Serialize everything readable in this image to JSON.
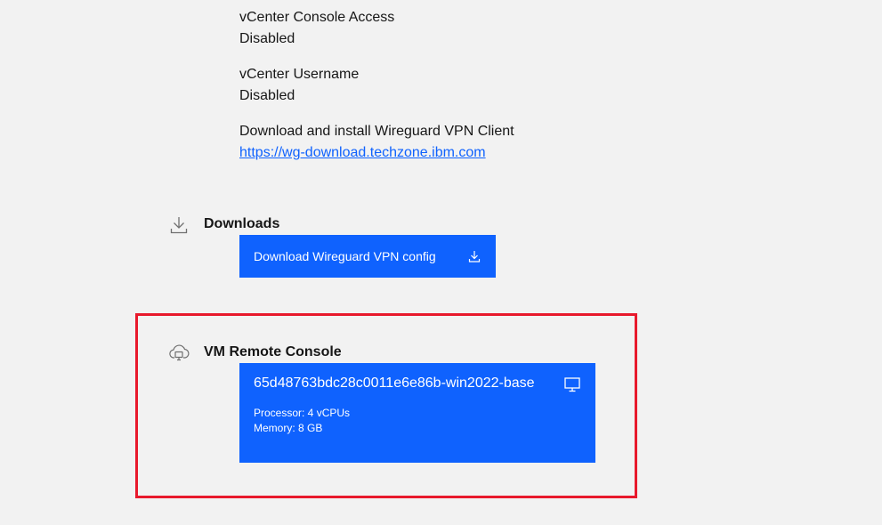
{
  "fields": [
    {
      "label": "vCenter Console Access",
      "value": "Disabled"
    },
    {
      "label": "vCenter Username",
      "value": "Disabled"
    }
  ],
  "wireguard": {
    "label": "Download and install Wireguard VPN Client",
    "link": "https://wg-download.techzone.ibm.com"
  },
  "downloads": {
    "title": "Downloads",
    "icon": "download-icon",
    "button_label": "Download Wireguard VPN config",
    "button_icon": "download-icon"
  },
  "vm_console": {
    "title": "VM Remote Console",
    "icon": "cloud-monitor-icon",
    "vm_name": "65d48763bdc28c0011e6e86b-win2022-base",
    "processor": "Processor: 4 vCPUs",
    "memory": "Memory: 8 GB",
    "tile_icon": "monitor-icon"
  },
  "colors": {
    "background": "#f2f2f2",
    "primary": "#0f62fe",
    "link": "#0f62fe",
    "highlight": "#e8192c"
  }
}
